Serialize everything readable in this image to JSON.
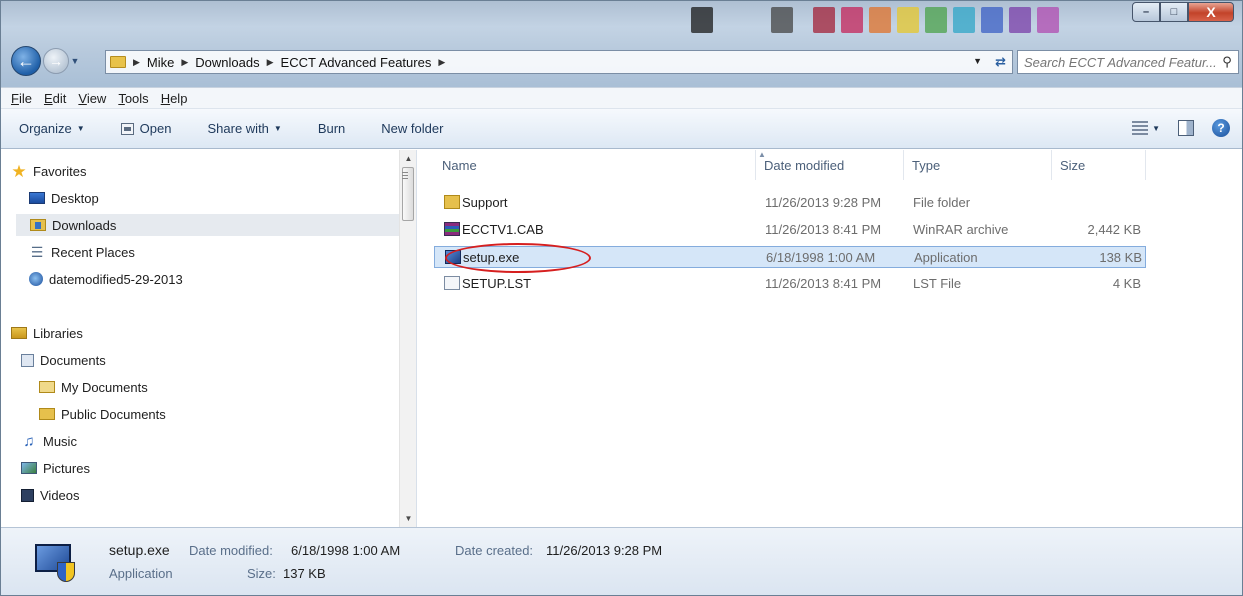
{
  "window": {
    "caption": {
      "minimize": "–",
      "maximize": "□",
      "close": "X"
    }
  },
  "address": {
    "crumbs": [
      "Mike",
      "Downloads",
      "ECCT Advanced Features"
    ],
    "search_placeholder": "Search ECCT Advanced Featur..."
  },
  "menu": [
    "File",
    "Edit",
    "View",
    "Tools",
    "Help"
  ],
  "menu_underline": [
    "F",
    "E",
    "V",
    "T",
    "H"
  ],
  "menu_rest": [
    "ile",
    "dit",
    "iew",
    "ools",
    "elp"
  ],
  "commands": {
    "organize": "Organize",
    "open": "Open",
    "share_with": "Share with",
    "burn": "Burn",
    "new_folder": "New folder"
  },
  "nav": {
    "favorites": "Favorites",
    "desktop": "Desktop",
    "downloads": "Downloads",
    "recent_places": "Recent Places",
    "saved_search": "datemodified5-29-2013",
    "libraries": "Libraries",
    "documents": "Documents",
    "my_documents": "My Documents",
    "public_documents": "Public Documents",
    "music": "Music",
    "pictures": "Pictures",
    "videos": "Videos"
  },
  "columns": {
    "name": "Name",
    "date": "Date modified",
    "type": "Type",
    "size": "Size"
  },
  "files": [
    {
      "name": "Support",
      "date": "11/26/2013 9:28 PM",
      "type": "File folder",
      "size": "",
      "icon": "folder-icon"
    },
    {
      "name": "ECCTV1.CAB",
      "date": "11/26/2013 8:41 PM",
      "type": "WinRAR archive",
      "size": "2,442 KB",
      "icon": "winrar-icon"
    },
    {
      "name": "setup.exe",
      "date": "6/18/1998 1:00 AM",
      "type": "Application",
      "size": "138 KB",
      "icon": "application-icon"
    },
    {
      "name": "SETUP.LST",
      "date": "11/26/2013 8:41 PM",
      "type": "LST File",
      "size": "4 KB",
      "icon": "lst-file-icon"
    }
  ],
  "details": {
    "name": "setup.exe",
    "modified_label": "Date modified:",
    "modified_value": "6/18/1998 1:00 AM",
    "created_label": "Date created:",
    "created_value": "11/26/2013 9:28 PM",
    "type": "Application",
    "size_label": "Size:",
    "size_value": "137 KB"
  },
  "colors": {
    "selection": "#d5e6f8",
    "highlight_ring": "#d61f1f",
    "accent": "#1e395b"
  }
}
